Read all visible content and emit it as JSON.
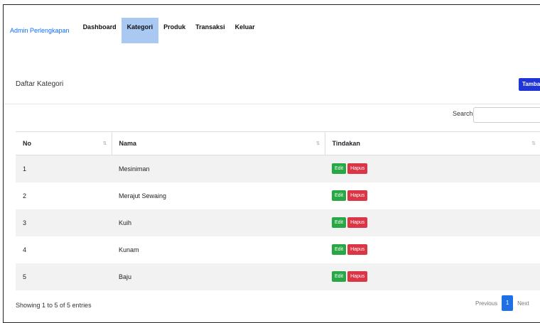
{
  "navbar": {
    "brand": "Admin Perlengkapan",
    "items": [
      {
        "label": "Dashboard"
      },
      {
        "label": "Kategori"
      },
      {
        "label": "Produk"
      },
      {
        "label": "Transaksi"
      },
      {
        "label": "Keluar"
      }
    ]
  },
  "card": {
    "title": "Daftar Kategori",
    "add_label": "Tambah"
  },
  "search": {
    "label": "Search:",
    "value": ""
  },
  "table": {
    "headers": [
      "No",
      "Nama",
      "Tindakan"
    ],
    "rows": [
      {
        "no": "1",
        "nama": "Mesiniman"
      },
      {
        "no": "2",
        "nama": "Merajut Sewaing"
      },
      {
        "no": "3",
        "nama": "Kuih"
      },
      {
        "no": "4",
        "nama": "Kunam"
      },
      {
        "no": "5",
        "nama": "Baju"
      }
    ],
    "edit_label": "Edit",
    "delete_label": "Hapus"
  },
  "footer": {
    "info": "Showing 1 to 5 of 5 entries",
    "prev": "Previous",
    "page": "1",
    "next": "Next"
  },
  "colors": {
    "accent": "#0d6efd",
    "active_nav": "#a9c9f3",
    "edit": "#28a745",
    "delete": "#dc3545"
  }
}
